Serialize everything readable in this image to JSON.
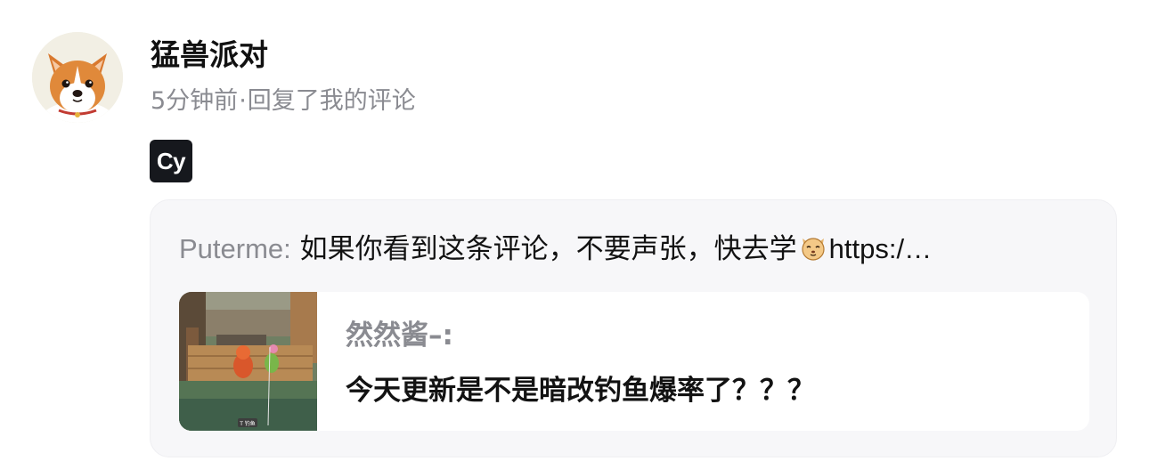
{
  "comment": {
    "username": "猛兽派对",
    "time": "5分钟前",
    "separator": "·",
    "action": "回复了我的评论",
    "badge": "Cy"
  },
  "quote": {
    "author": "Puterme:",
    "text": "如果你看到这条评论，不要声张，快去学",
    "emoji_icon": "cat-face-icon",
    "link": "https:/…"
  },
  "card": {
    "author": "然然酱–:",
    "text": "今天更新是不是暗改钓鱼爆率了？？？",
    "thumbnail_label": "T 钓鱼"
  }
}
